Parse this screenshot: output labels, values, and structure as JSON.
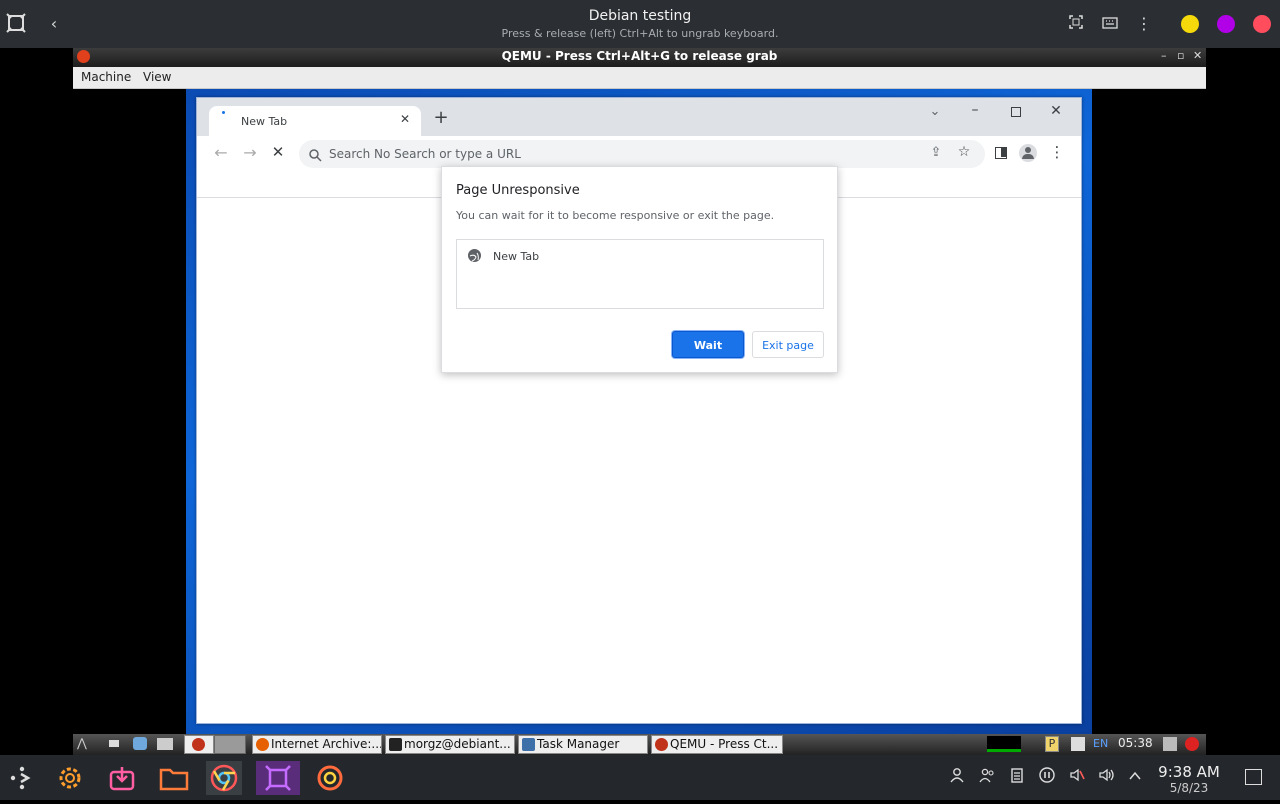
{
  "host": {
    "title": "Debian testing",
    "subtitle": "Press & release (left) Ctrl+Alt to ungrab keyboard.",
    "colors": {
      "yellow": "#f5d90a",
      "purple": "#b100e8",
      "red": "#ff4d5e"
    }
  },
  "qemu": {
    "title": "QEMU - Press Ctrl+Alt+G to release grab",
    "menu": [
      "Machine",
      "View"
    ]
  },
  "chrome": {
    "tab_title": "New Tab",
    "omnibox_placeholder": "Search No Search or type a URL"
  },
  "dialog": {
    "title": "Page Unresponsive",
    "message": "You can wait for it to become responsive or exit the page.",
    "page_item": "New Tab",
    "wait_label": "Wait",
    "exit_label": "Exit page"
  },
  "guest_taskbar": {
    "tasks": [
      "Internet Archive:...",
      "morgz@debiant...",
      "Task Manager",
      "QEMU - Press Ct..."
    ],
    "lang": "EN",
    "clock": "05:38"
  },
  "host_tray": {
    "time": "9:38 AM",
    "date": "5/8/23"
  }
}
